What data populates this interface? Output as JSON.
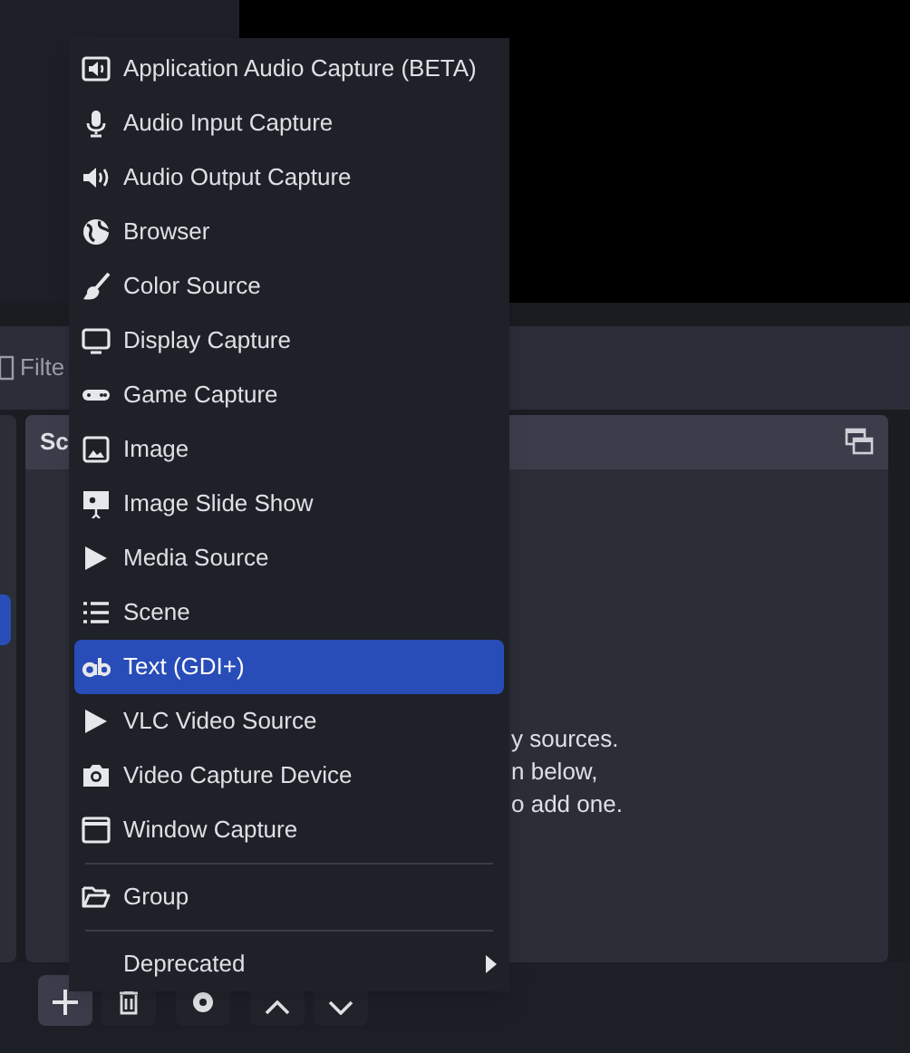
{
  "filter_bar": {
    "label": "Filte"
  },
  "sources_panel": {
    "title": "Sc",
    "hint_lines": [
      "y sources.",
      "n below,",
      "o add one."
    ]
  },
  "scenes_panel": {
    "items": [
      {
        "selected": true
      }
    ]
  },
  "toolbar": {
    "buttons": [
      {
        "kind": "add"
      },
      {
        "kind": "remove"
      },
      {
        "kind": "settings"
      },
      {
        "kind": "up"
      },
      {
        "kind": "down"
      }
    ]
  },
  "menu": {
    "items": [
      {
        "kind": "item",
        "label": "Application Audio Capture (BETA)",
        "selected": false
      },
      {
        "kind": "item",
        "label": "Audio Input Capture",
        "selected": false
      },
      {
        "kind": "item",
        "label": "Audio Output Capture",
        "selected": false
      },
      {
        "kind": "item",
        "label": "Browser",
        "selected": false
      },
      {
        "kind": "item",
        "label": "Color Source",
        "selected": false
      },
      {
        "kind": "item",
        "label": "Display Capture",
        "selected": false
      },
      {
        "kind": "item",
        "label": "Game Capture",
        "selected": false
      },
      {
        "kind": "item",
        "label": "Image",
        "selected": false
      },
      {
        "kind": "item",
        "label": "Image Slide Show",
        "selected": false
      },
      {
        "kind": "item",
        "label": "Media Source",
        "selected": false
      },
      {
        "kind": "item",
        "label": "Scene",
        "selected": false
      },
      {
        "kind": "item",
        "label": "Text (GDI+)",
        "selected": true
      },
      {
        "kind": "item",
        "label": "VLC Video Source",
        "selected": false
      },
      {
        "kind": "item",
        "label": "Video Capture Device",
        "selected": false
      },
      {
        "kind": "item",
        "label": "Window Capture",
        "selected": false
      },
      {
        "kind": "separator"
      },
      {
        "kind": "item",
        "label": "Group",
        "selected": false
      },
      {
        "kind": "separator"
      },
      {
        "kind": "submenu",
        "label": "Deprecated",
        "selected": false
      }
    ]
  }
}
